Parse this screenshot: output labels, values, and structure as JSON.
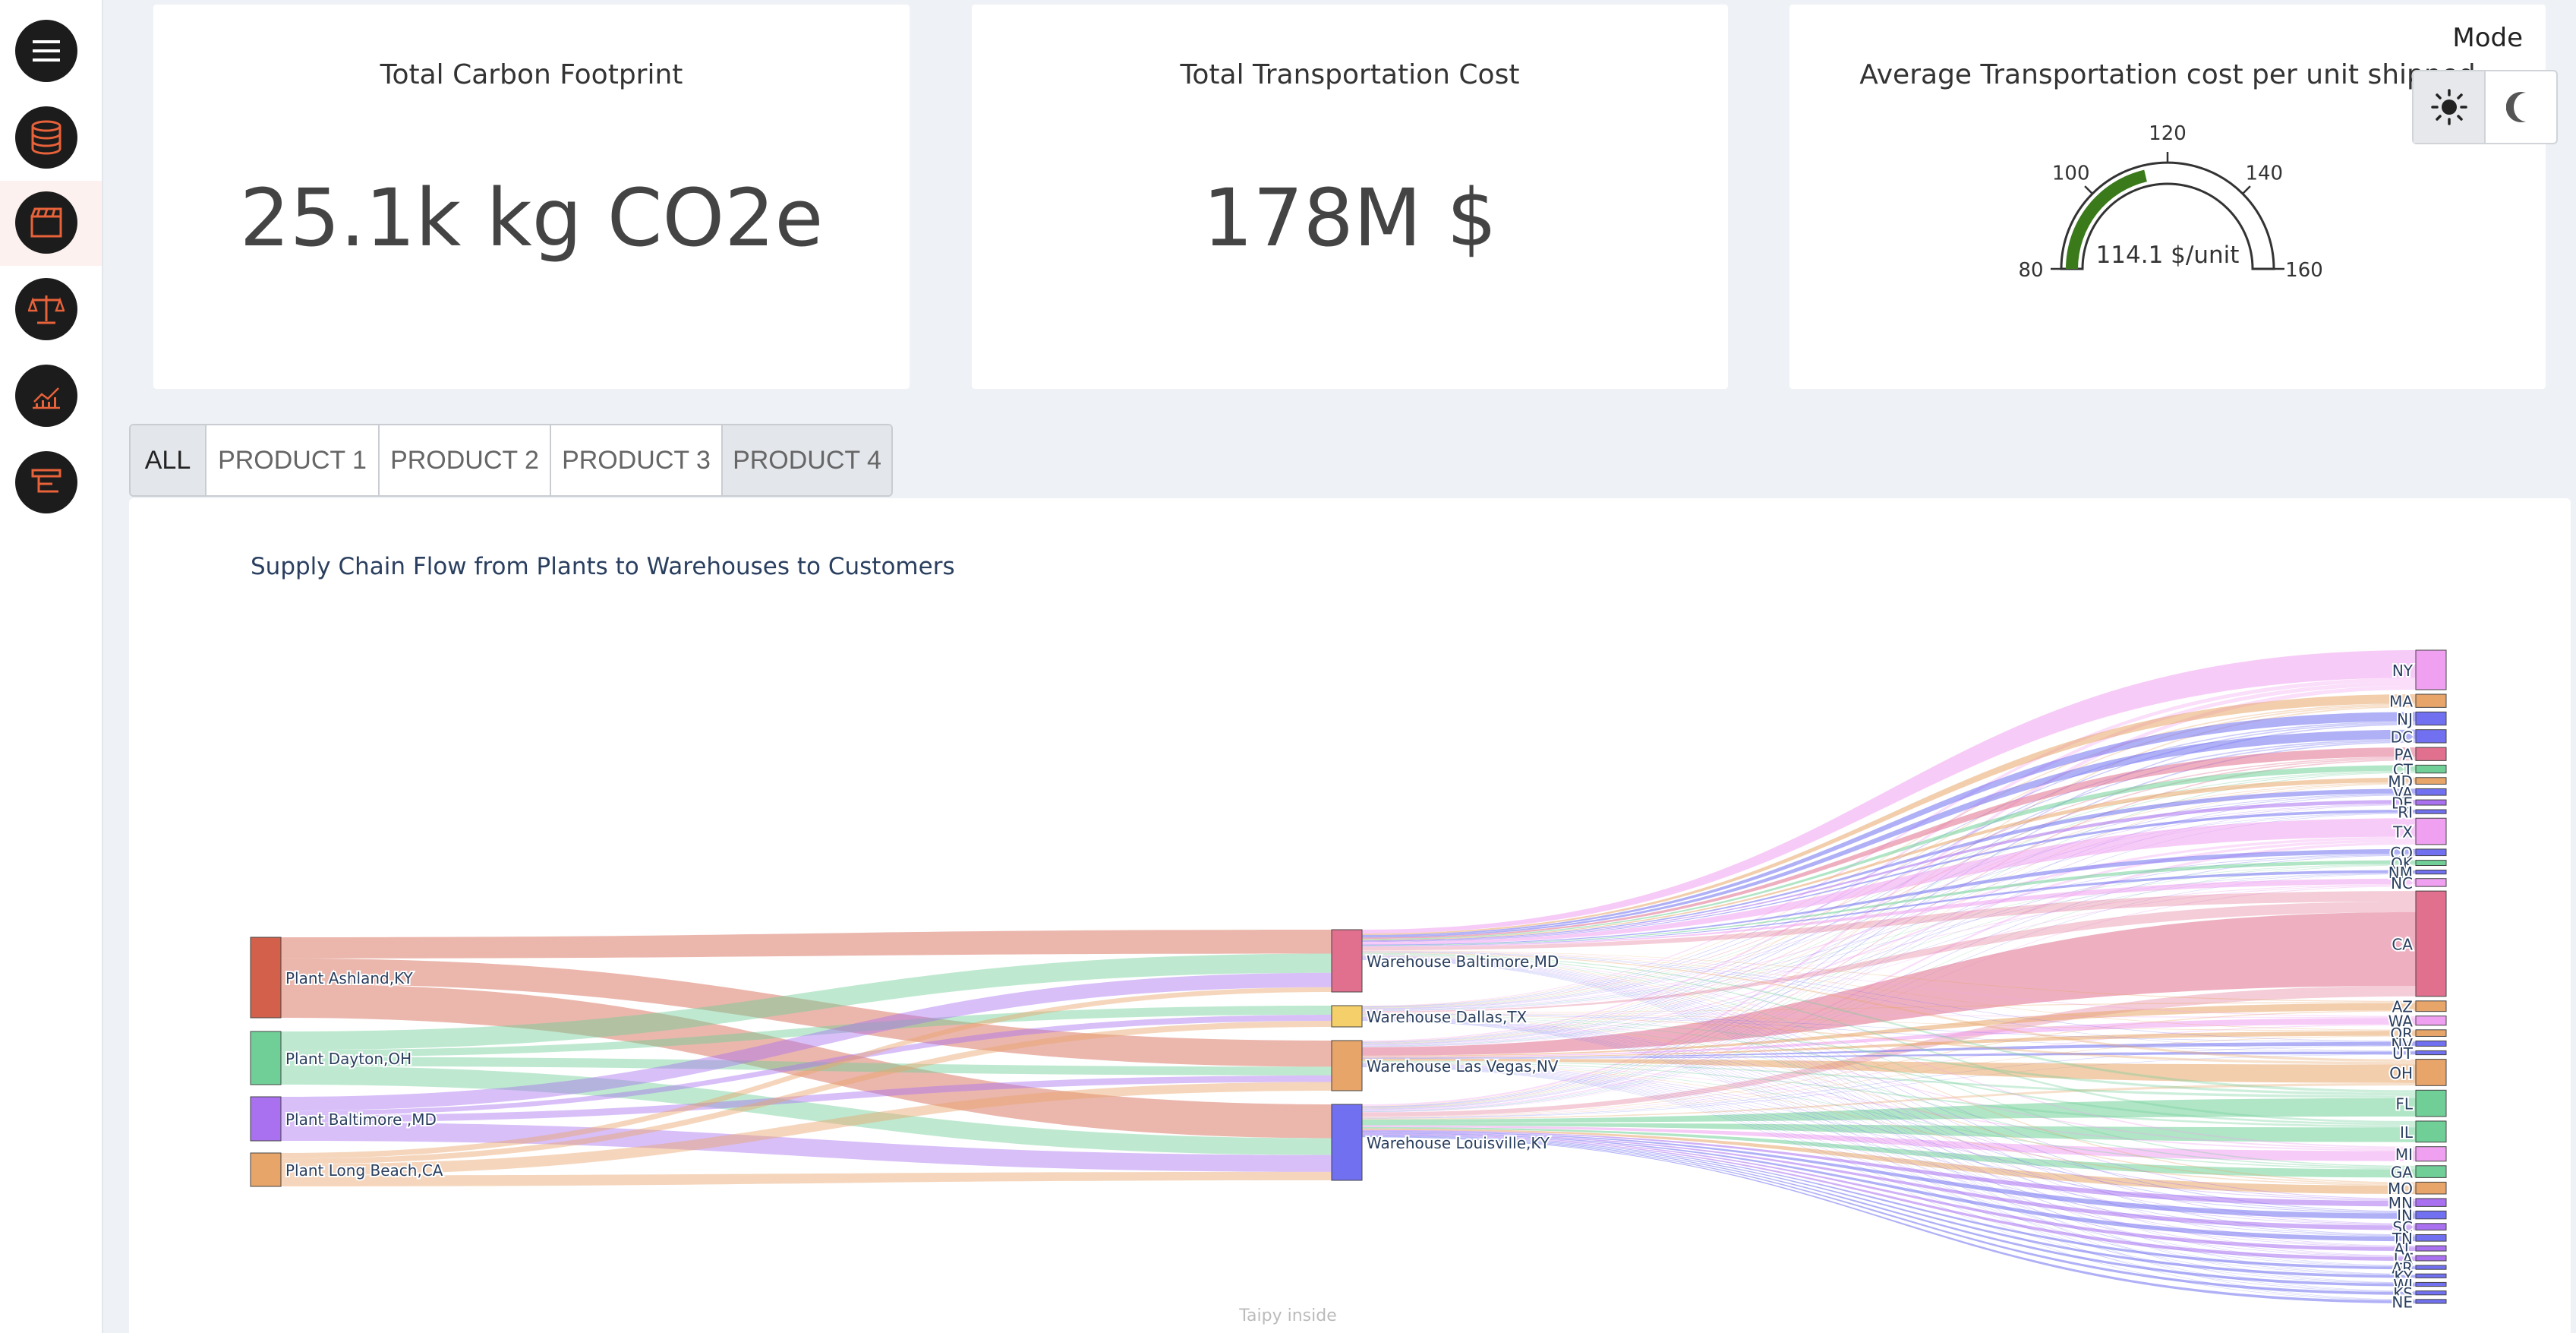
{
  "sidebar": {
    "items": [
      {
        "name": "menu",
        "icon": "hamburger-menu-icon"
      },
      {
        "name": "data",
        "icon": "database-icon"
      },
      {
        "name": "scenario",
        "icon": "clapperboard-icon",
        "active": true
      },
      {
        "name": "compare",
        "icon": "scale-icon"
      },
      {
        "name": "analytics",
        "icon": "chart-icon"
      },
      {
        "name": "cycles",
        "icon": "tree-structure-icon"
      }
    ],
    "accent": "#e8623a"
  },
  "kpis": {
    "carbon": {
      "title": "Total Carbon Footprint",
      "value": "25.1k kg CO2e"
    },
    "cost": {
      "title": "Total Transportation Cost",
      "value": "178M $"
    },
    "avg": {
      "title": "Average Transportation cost per unit shipped",
      "gauge": {
        "min": 80,
        "max": 160,
        "value": 114.1,
        "value_text": "114.1 $/unit",
        "ticks": [
          "80",
          "100",
          "120",
          "140",
          "160"
        ],
        "bar_color": "#3a7a1a"
      }
    }
  },
  "mode": {
    "label": "Mode",
    "options": [
      "light",
      "dark"
    ],
    "selected": "light"
  },
  "tabs": [
    {
      "label": "ALL",
      "active": true
    },
    {
      "label": "PRODUCT 1"
    },
    {
      "label": "PRODUCT 2"
    },
    {
      "label": "PRODUCT 3"
    },
    {
      "label": "PRODUCT 4",
      "shaded": true
    }
  ],
  "chart_data": {
    "type": "sankey",
    "title": "Supply Chain Flow from Plants to Warehouses to Customers",
    "plants": [
      {
        "label": "Plant Ashland,KY",
        "color": "#d2604a"
      },
      {
        "label": "Plant Dayton,OH",
        "color": "#6fcf97"
      },
      {
        "label": "Plant Baltimore ,MD",
        "color": "#a970f0"
      },
      {
        "label": "Plant Long Beach,CA",
        "color": "#e8a56a"
      }
    ],
    "warehouses": [
      {
        "label": "Warehouse Baltimore,MD",
        "color": "#e0708e"
      },
      {
        "label": "Warehouse Dallas,TX",
        "color": "#f5d06a"
      },
      {
        "label": "Warehouse Las Vegas,NV",
        "color": "#e8a56a"
      },
      {
        "label": "Warehouse Louisville,KY",
        "color": "#7070f0"
      }
    ],
    "customers": [
      {
        "label": "NY",
        "w": 3,
        "color": "#f0a0f0"
      },
      {
        "label": "MA",
        "w": 1,
        "color": "#e8a56a"
      },
      {
        "label": "NJ",
        "w": 1,
        "color": "#7070f0"
      },
      {
        "label": "DC",
        "w": 1,
        "color": "#7070f0"
      },
      {
        "label": "PA",
        "w": 1,
        "color": "#e0708e"
      },
      {
        "label": "CT",
        "w": 0.6,
        "color": "#6fcf97"
      },
      {
        "label": "MD",
        "w": 0.5,
        "color": "#e8a56a"
      },
      {
        "label": "VA",
        "w": 0.5,
        "color": "#7070f0"
      },
      {
        "label": "DE",
        "w": 0.4,
        "color": "#a970f0"
      },
      {
        "label": "RI",
        "w": 0.3,
        "color": "#7070f0"
      },
      {
        "label": "TX",
        "w": 2,
        "color": "#f0a0f0"
      },
      {
        "label": "CO",
        "w": 0.5,
        "color": "#7070f0"
      },
      {
        "label": "OK",
        "w": 0.4,
        "color": "#6fcf97"
      },
      {
        "label": "NM",
        "w": 0.3,
        "color": "#7070f0"
      },
      {
        "label": "NC",
        "w": 0.6,
        "color": "#f0a0f0"
      },
      {
        "label": "CA",
        "w": 8,
        "color": "#e0708e"
      },
      {
        "label": "AZ",
        "w": 0.8,
        "color": "#e8a56a"
      },
      {
        "label": "WA",
        "w": 0.7,
        "color": "#f0a0f0"
      },
      {
        "label": "OR",
        "w": 0.5,
        "color": "#e8a56a"
      },
      {
        "label": "NV",
        "w": 0.4,
        "color": "#7070f0"
      },
      {
        "label": "UT",
        "w": 0.3,
        "color": "#7070f0"
      },
      {
        "label": "OH",
        "w": 2,
        "color": "#e8a56a"
      },
      {
        "label": "FL",
        "w": 2,
        "color": "#6fcf97"
      },
      {
        "label": "IL",
        "w": 1.6,
        "color": "#6fcf97"
      },
      {
        "label": "MI",
        "w": 1.1,
        "color": "#f0a0f0"
      },
      {
        "label": "GA",
        "w": 0.9,
        "color": "#6fcf97"
      },
      {
        "label": "MO",
        "w": 0.9,
        "color": "#e8a56a"
      },
      {
        "label": "MN",
        "w": 0.6,
        "color": "#a970f0"
      },
      {
        "label": "IN",
        "w": 0.6,
        "color": "#7070f0"
      },
      {
        "label": "SC",
        "w": 0.5,
        "color": "#a970f0"
      },
      {
        "label": "TN",
        "w": 0.5,
        "color": "#7070f0"
      },
      {
        "label": "AL",
        "w": 0.4,
        "color": "#a970f0"
      },
      {
        "label": "LA",
        "w": 0.4,
        "color": "#a970f0"
      },
      {
        "label": "AR",
        "w": 0.3,
        "color": "#7070f0"
      },
      {
        "label": "KY",
        "w": 0.3,
        "color": "#7070f0"
      },
      {
        "label": "WI",
        "w": 0.3,
        "color": "#7070f0"
      },
      {
        "label": "KS",
        "w": 0.3,
        "color": "#7070f0"
      },
      {
        "label": "NE",
        "w": 0.3,
        "color": "#7070f0"
      }
    ],
    "plant_to_warehouse": [
      {
        "from": 0,
        "to": 0,
        "value": 5
      },
      {
        "from": 0,
        "to": 2,
        "value": 6
      },
      {
        "from": 0,
        "to": 3,
        "value": 8
      },
      {
        "from": 1,
        "to": 0,
        "value": 4
      },
      {
        "from": 1,
        "to": 1,
        "value": 1.5
      },
      {
        "from": 1,
        "to": 2,
        "value": 2
      },
      {
        "from": 1,
        "to": 3,
        "value": 4
      },
      {
        "from": 2,
        "to": 0,
        "value": 3
      },
      {
        "from": 2,
        "to": 1,
        "value": 1
      },
      {
        "from": 2,
        "to": 2,
        "value": 1.5
      },
      {
        "from": 2,
        "to": 3,
        "value": 4
      },
      {
        "from": 3,
        "to": 0,
        "value": 1
      },
      {
        "from": 3,
        "to": 1,
        "value": 1
      },
      {
        "from": 3,
        "to": 2,
        "value": 2
      },
      {
        "from": 3,
        "to": 3,
        "value": 2
      }
    ]
  },
  "footer": {
    "text": "Taipy inside"
  }
}
